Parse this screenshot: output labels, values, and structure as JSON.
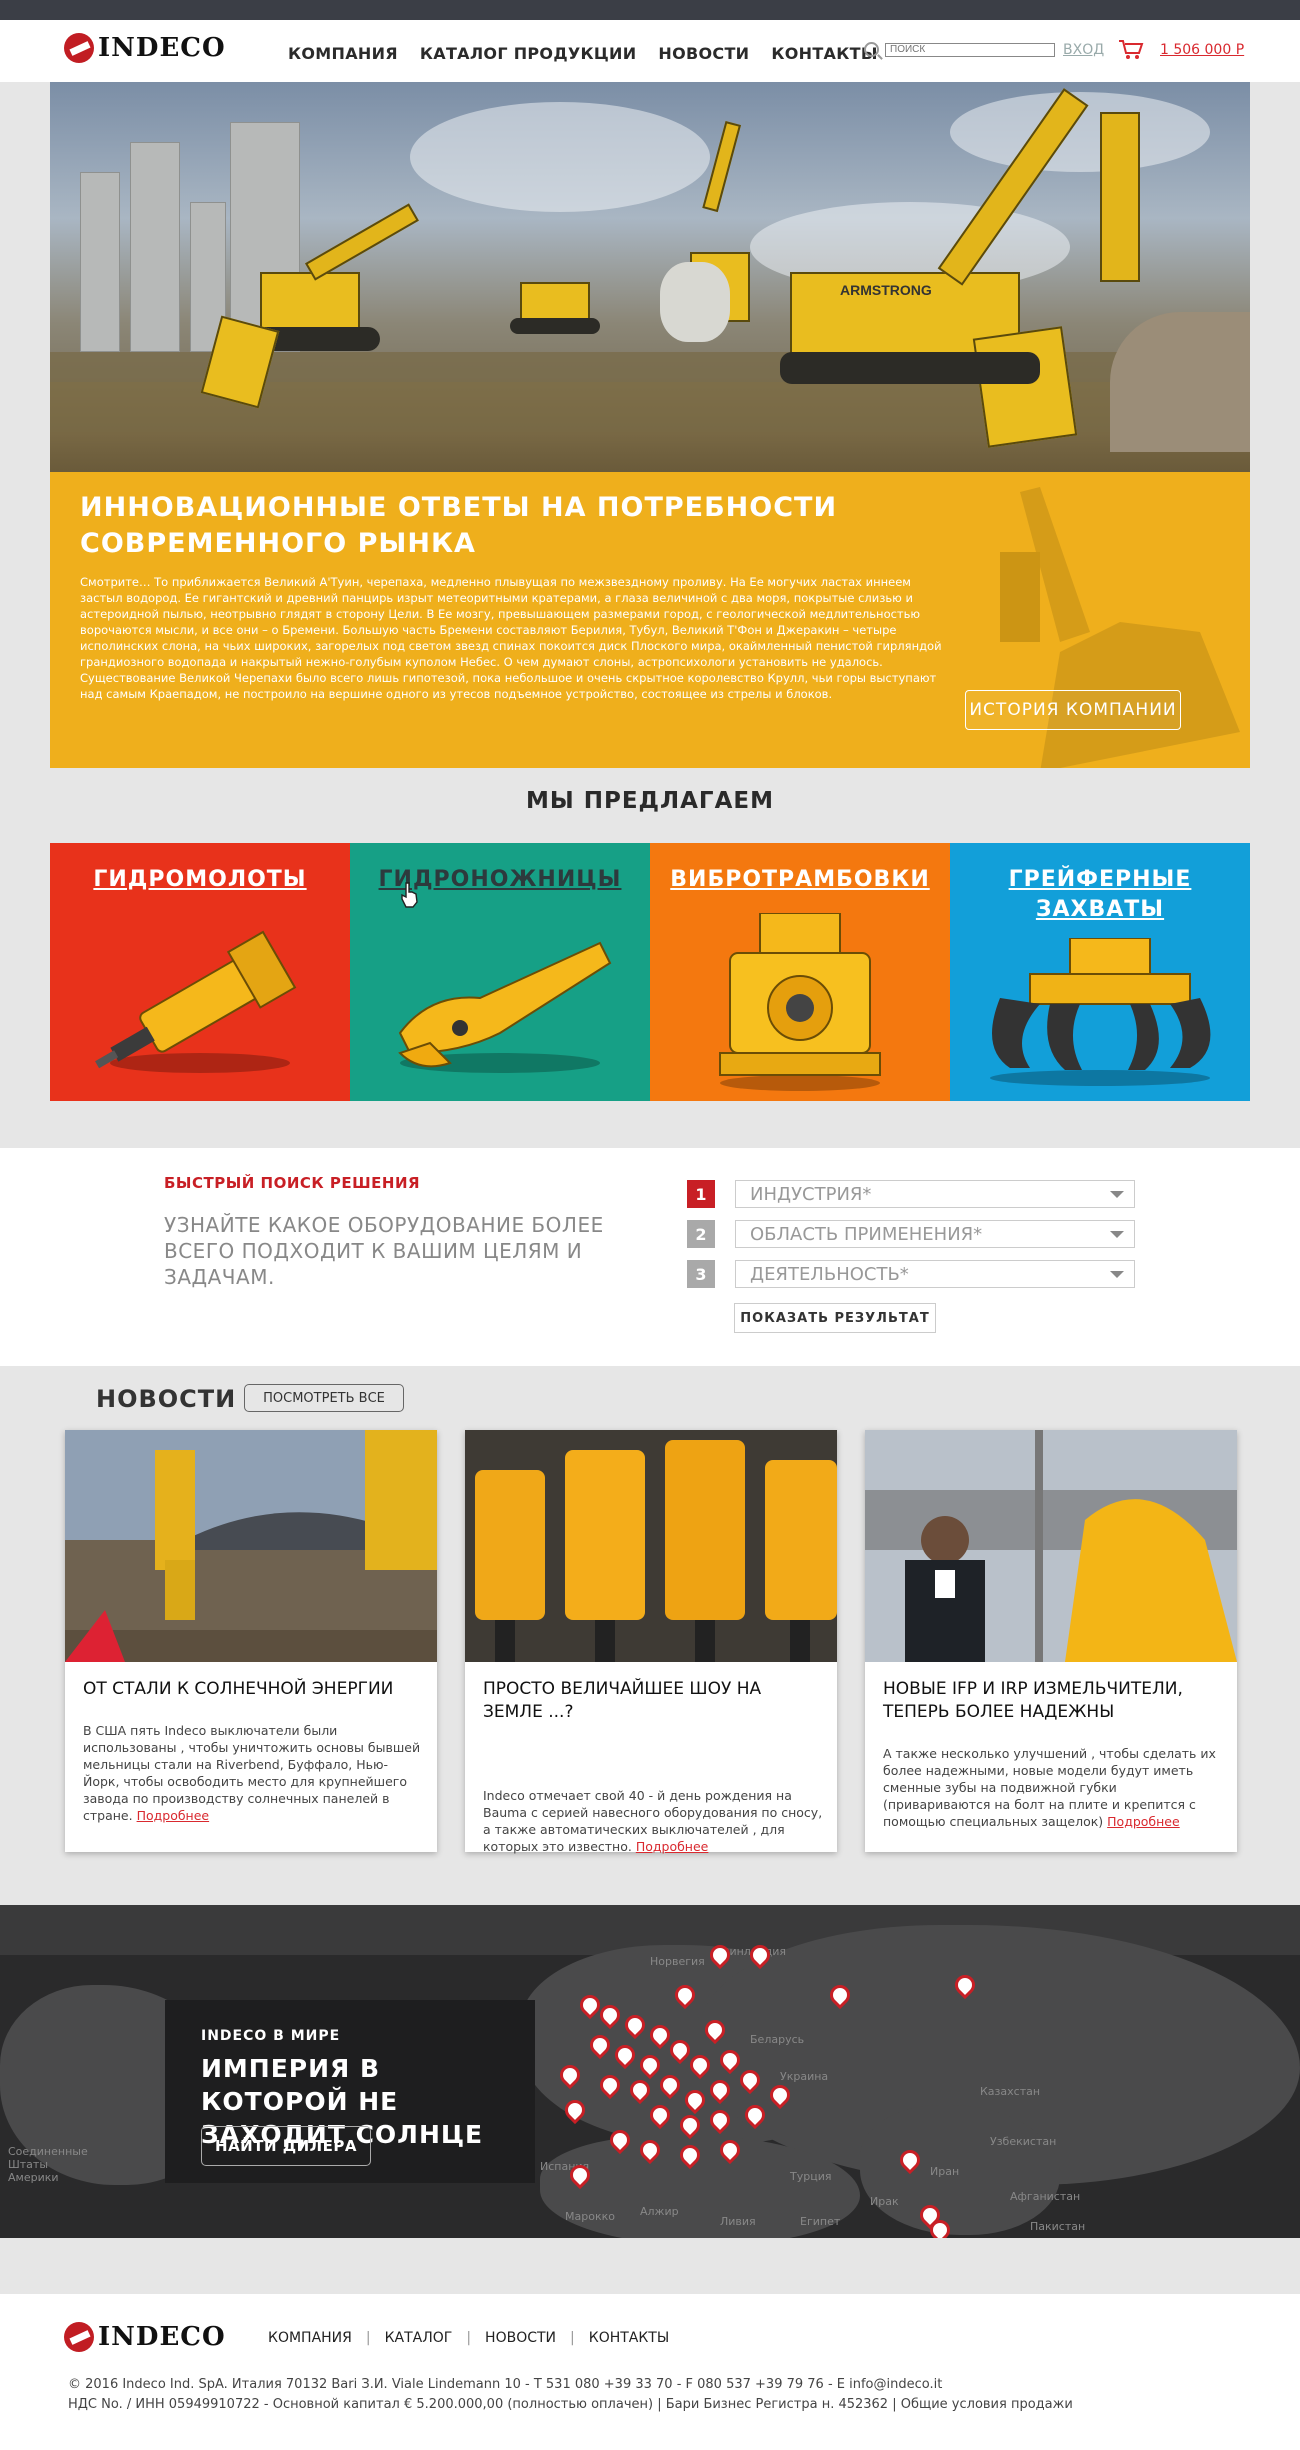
{
  "header": {
    "logo_text": "INDECO",
    "nav": [
      "КОМПАНИЯ",
      "КАТАЛОГ ПРОДУКЦИИ",
      "НОВОСТИ",
      "КОНТАКТЫ"
    ],
    "search_placeholder": "ПОИСК",
    "login": "ВХОД",
    "cart_total": "1 506 000 Р"
  },
  "hero": {
    "panel_title": "ИННОВАЦИОННЫЕ ОТВЕТЫ НА ПОТРЕБНОСТИ СОВРЕМЕННОГО РЫНКА",
    "panel_text": "Смотрите… То приближается Великий А'Туин, черепаха, медленно плывущая по межзвездному проливу. На Ее могучих ластах иннеем застыл водород. Ее гигантский и древний панцирь изрыт метеоритными кратерами, а глаза величиной с два моря, покрытые слизью и астероидной пылью, неотрывно глядят в сторону Цели. В Ее мозгу, превышающем размерами город, с геологической медлительностью ворочаются мысли, и все они – о Бремени. Большую часть Бремени составляют Берилия, Тубул, Великий Т'Фон и Джеракин – четыре исполинских слона, на чьих широких, загорелых под светом звезд спинах покоится диск Плоского мира, окаймленный пенистой гирляндой грандиозного водопада и накрытый нежно-голубым куполом Небес. О чем думают слоны, астропсихологи установить не удалось. Существование Великой Черепахи было всего лишь гипотезой, пока небольшое и очень скрытное королевство Крулл, чьи горы выступают над самым Краепадом, не построило на вершине одного из утесов подъемное устройство, состоящее из стрелы и блоков.",
    "button": "ИСТОРИЯ КОМПАНИИ",
    "machine_label": "ARMSTRONG"
  },
  "offer": {
    "title": "МЫ ПРЕДЛАГАЕМ",
    "tiles": [
      {
        "label": "ГИДРОМОЛОТЫ",
        "color": "#e8321b"
      },
      {
        "label": "ГИДРОНОЖНИЦЫ",
        "color": "#16a086"
      },
      {
        "label": "ВИБРОТРАМБОВКИ",
        "color": "#f4780f"
      },
      {
        "label": "ГРЕЙФЕРНЫЕ ЗАХВАТЫ",
        "color": "#129fd9"
      }
    ]
  },
  "quick": {
    "label": "БЫСТРЫЙ ПОИСК РЕШЕНИЯ",
    "text": "УЗНАЙТЕ КАКОЕ ОБОРУДОВАНИЕ БОЛЕЕ ВСЕГО ПОДХОДИТ К ВАШИМ ЦЕЛЯМ И ЗАДАЧАМ.",
    "selects": [
      {
        "num": "1",
        "label": "ИНДУСТРИЯ*",
        "color": "#c81f25"
      },
      {
        "num": "2",
        "label": "ОБЛАСТЬ ПРИМЕНЕНИЯ*",
        "color": "#a9a9a9"
      },
      {
        "num": "3",
        "label": "ДЕЯТЕЛЬНОСТЬ*",
        "color": "#a9a9a9"
      }
    ],
    "button": "ПОКАЗАТЬ РЕЗУЛЬТАТ"
  },
  "news": {
    "title": "НОВОСТИ",
    "all": "ПОСМОТРЕТЬ ВСЕ",
    "more": "Подробнее",
    "items": [
      {
        "title": "ОТ СТАЛИ К СОЛНЕЧНОЙ ЭНЕРГИИ",
        "text": "В США пять Indeco выключатели были использованы , чтобы уничтожить основы бывшей мельницы стали на Riverbend, Буффало, Нью-Йорк, чтобы освободить место для крупнейшего завода по производству солнечных панелей в стране."
      },
      {
        "title": "ПРОСТО ВЕЛИЧАЙШЕЕ ШОУ НА ЗЕМЛЕ ...?",
        "text": "Indeco отмечает свой 40 - й день рождения на Bauma с серией навесного оборудования по сносу, а также автоматических выключателей , для которых это известно."
      },
      {
        "title": "НОВЫЕ IFP И IRP ИЗМЕЛЬЧИТЕЛИ, ТЕПЕРЬ БОЛЕЕ НАДЕЖНЫ",
        "text": "А также несколько улучшений , чтобы сделать их более надежными, новые модели будут иметь сменные зубы на подвижной губки (привариваются на болт на плите и крепится с помощью специальных защелок)"
      }
    ]
  },
  "world": {
    "small": "INDECO В МИРЕ",
    "big": "ИМПЕРИЯ В КОТОРОЙ НЕ ЗАХОДИТ СОЛНЦЕ",
    "button": "НАЙТИ ДИЛЕРА",
    "labels": [
      "Норвегия",
      "Финляндия",
      "Беларусь",
      "Украина",
      "Казахстан",
      "Узбекистан",
      "Турция",
      "Афганистан",
      "Пакистан",
      "Марокко",
      "Алжир",
      "Ливия",
      "Египет",
      "Иран",
      "Ирак",
      "Испания",
      "Соединенные Штаты Америки"
    ]
  },
  "footer": {
    "logo_text": "INDECO",
    "nav": [
      "КОМПАНИЯ",
      "КАТАЛОГ",
      "НОВОСТИ",
      "КОНТАКТЫ"
    ],
    "line1": "© 2016 Indeco Ind. SpA. Италия 70132 Bari З.И. Viale Lindemann 10 - T 531 080 +39 33 70 - F 080 537 +39 79 76 - E info@indeco.it",
    "line2": "НДС No. / ИНН 05949910722 - Основной капитал € 5.200.000,00 (полностью оплачен) | Бари Бизнес Регистра н. 452362 | Общие условия продажи"
  }
}
